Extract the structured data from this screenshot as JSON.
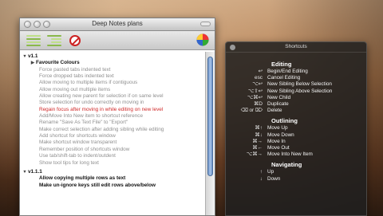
{
  "main_window": {
    "title": "Deep Notes plans",
    "toolbar": {
      "colors": [
        "#8ab84a",
        "#bfe08a",
        "#cc2222"
      ]
    },
    "outline": [
      {
        "text": "v1.1",
        "level": 0,
        "style": "head",
        "disc": "▼"
      },
      {
        "text": "Favourite Colours",
        "level": 1,
        "style": "head",
        "disc": "▶"
      },
      {
        "text": "Force pasted tabs indented text",
        "level": 2,
        "style": "gray"
      },
      {
        "text": "Force dropped tabs indented text",
        "level": 2,
        "style": "gray"
      },
      {
        "text": "Allow moving to multiple items if contiguous",
        "level": 2,
        "style": "gray"
      },
      {
        "text": "Allow moving out multiple items",
        "level": 2,
        "style": "gray"
      },
      {
        "text": "Allow creating new parent for selection if on same level",
        "level": 2,
        "style": "gray"
      },
      {
        "text": "Store selection for undo correctly on moving in",
        "level": 2,
        "style": "gray"
      },
      {
        "text": "Regain focus after moving in while editing on new level",
        "level": 2,
        "style": "red"
      },
      {
        "text": "Add/Move Into New item to shortcut reference",
        "level": 2,
        "style": "gray"
      },
      {
        "text": "Rename \"Save As Text File\" to \"Export\"",
        "level": 2,
        "style": "gray"
      },
      {
        "text": "Make correct selection after adding sibling while editing",
        "level": 2,
        "style": "gray"
      },
      {
        "text": "Add shortcut for shortcuts window",
        "level": 2,
        "style": "gray"
      },
      {
        "text": "Make shortcut window transparent",
        "level": 2,
        "style": "gray"
      },
      {
        "text": "Remember position of shortcuts window",
        "level": 2,
        "style": "gray"
      },
      {
        "text": "Use tab/shift-tab to indent/outdent",
        "level": 2,
        "style": "gray"
      },
      {
        "text": "Show tool tips for long text",
        "level": 2,
        "style": "gray"
      },
      {
        "text": "",
        "level": 0,
        "style": "sep"
      },
      {
        "text": "v1.1.1",
        "level": 0,
        "style": "head",
        "disc": "▼"
      },
      {
        "text": "Allow copying multiple rows as text",
        "level": 2,
        "style": "head-dark"
      },
      {
        "text": "Make un-ignore keys still edit rows above/below",
        "level": 2,
        "style": "head-dark"
      }
    ]
  },
  "shortcuts": {
    "title": "Shortcuts",
    "sections": [
      {
        "name": "Editing",
        "rows": [
          {
            "key": "↩",
            "action": "Begin/End Editing"
          },
          {
            "key": "esc",
            "action": "Cancel Editing"
          },
          {
            "key": "⌥↩",
            "action": "New Sibling Below Selection"
          },
          {
            "key": "⌥⇧↩",
            "action": "New Sibling Above Selection"
          },
          {
            "key": "⌥⌘↩",
            "action": "New Child"
          },
          {
            "key": "⌘D",
            "action": "Duplicate"
          },
          {
            "key": "⌫ or ⌦",
            "action": "Delete"
          }
        ]
      },
      {
        "name": "Outlining",
        "rows": [
          {
            "key": "⌘↑",
            "action": "Move Up"
          },
          {
            "key": "⌘↓",
            "action": "Move Down"
          },
          {
            "key": "⌘→",
            "action": "Move In"
          },
          {
            "key": "⌘←",
            "action": "Move Out"
          },
          {
            "key": "⌥⌘→",
            "action": "Move Into New Item"
          }
        ]
      },
      {
        "name": "Navigating",
        "rows": [
          {
            "key": "↑",
            "action": "Up"
          },
          {
            "key": "↓",
            "action": "Down"
          }
        ]
      }
    ]
  }
}
